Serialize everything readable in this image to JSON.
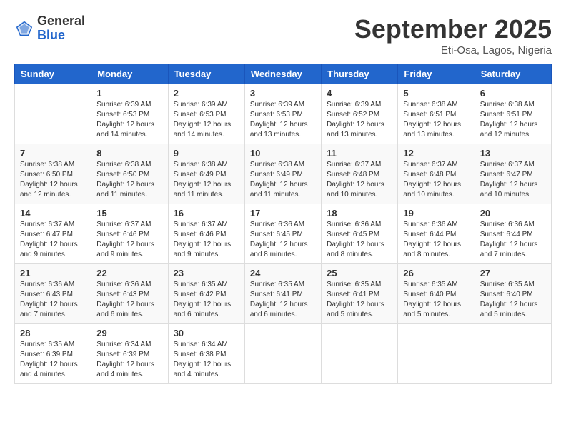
{
  "logo": {
    "general": "General",
    "blue": "Blue"
  },
  "header": {
    "month": "September 2025",
    "location": "Eti-Osa, Lagos, Nigeria"
  },
  "weekdays": [
    "Sunday",
    "Monday",
    "Tuesday",
    "Wednesday",
    "Thursday",
    "Friday",
    "Saturday"
  ],
  "weeks": [
    [
      {
        "day": "",
        "sunrise": "",
        "sunset": "",
        "daylight": ""
      },
      {
        "day": "1",
        "sunrise": "Sunrise: 6:39 AM",
        "sunset": "Sunset: 6:53 PM",
        "daylight": "Daylight: 12 hours and 14 minutes."
      },
      {
        "day": "2",
        "sunrise": "Sunrise: 6:39 AM",
        "sunset": "Sunset: 6:53 PM",
        "daylight": "Daylight: 12 hours and 14 minutes."
      },
      {
        "day": "3",
        "sunrise": "Sunrise: 6:39 AM",
        "sunset": "Sunset: 6:53 PM",
        "daylight": "Daylight: 12 hours and 13 minutes."
      },
      {
        "day": "4",
        "sunrise": "Sunrise: 6:39 AM",
        "sunset": "Sunset: 6:52 PM",
        "daylight": "Daylight: 12 hours and 13 minutes."
      },
      {
        "day": "5",
        "sunrise": "Sunrise: 6:38 AM",
        "sunset": "Sunset: 6:51 PM",
        "daylight": "Daylight: 12 hours and 13 minutes."
      },
      {
        "day": "6",
        "sunrise": "Sunrise: 6:38 AM",
        "sunset": "Sunset: 6:51 PM",
        "daylight": "Daylight: 12 hours and 12 minutes."
      }
    ],
    [
      {
        "day": "7",
        "sunrise": "Sunrise: 6:38 AM",
        "sunset": "Sunset: 6:50 PM",
        "daylight": "Daylight: 12 hours and 12 minutes."
      },
      {
        "day": "8",
        "sunrise": "Sunrise: 6:38 AM",
        "sunset": "Sunset: 6:50 PM",
        "daylight": "Daylight: 12 hours and 11 minutes."
      },
      {
        "day": "9",
        "sunrise": "Sunrise: 6:38 AM",
        "sunset": "Sunset: 6:49 PM",
        "daylight": "Daylight: 12 hours and 11 minutes."
      },
      {
        "day": "10",
        "sunrise": "Sunrise: 6:38 AM",
        "sunset": "Sunset: 6:49 PM",
        "daylight": "Daylight: 12 hours and 11 minutes."
      },
      {
        "day": "11",
        "sunrise": "Sunrise: 6:37 AM",
        "sunset": "Sunset: 6:48 PM",
        "daylight": "Daylight: 12 hours and 10 minutes."
      },
      {
        "day": "12",
        "sunrise": "Sunrise: 6:37 AM",
        "sunset": "Sunset: 6:48 PM",
        "daylight": "Daylight: 12 hours and 10 minutes."
      },
      {
        "day": "13",
        "sunrise": "Sunrise: 6:37 AM",
        "sunset": "Sunset: 6:47 PM",
        "daylight": "Daylight: 12 hours and 10 minutes."
      }
    ],
    [
      {
        "day": "14",
        "sunrise": "Sunrise: 6:37 AM",
        "sunset": "Sunset: 6:47 PM",
        "daylight": "Daylight: 12 hours and 9 minutes."
      },
      {
        "day": "15",
        "sunrise": "Sunrise: 6:37 AM",
        "sunset": "Sunset: 6:46 PM",
        "daylight": "Daylight: 12 hours and 9 minutes."
      },
      {
        "day": "16",
        "sunrise": "Sunrise: 6:37 AM",
        "sunset": "Sunset: 6:46 PM",
        "daylight": "Daylight: 12 hours and 9 minutes."
      },
      {
        "day": "17",
        "sunrise": "Sunrise: 6:36 AM",
        "sunset": "Sunset: 6:45 PM",
        "daylight": "Daylight: 12 hours and 8 minutes."
      },
      {
        "day": "18",
        "sunrise": "Sunrise: 6:36 AM",
        "sunset": "Sunset: 6:45 PM",
        "daylight": "Daylight: 12 hours and 8 minutes."
      },
      {
        "day": "19",
        "sunrise": "Sunrise: 6:36 AM",
        "sunset": "Sunset: 6:44 PM",
        "daylight": "Daylight: 12 hours and 8 minutes."
      },
      {
        "day": "20",
        "sunrise": "Sunrise: 6:36 AM",
        "sunset": "Sunset: 6:44 PM",
        "daylight": "Daylight: 12 hours and 7 minutes."
      }
    ],
    [
      {
        "day": "21",
        "sunrise": "Sunrise: 6:36 AM",
        "sunset": "Sunset: 6:43 PM",
        "daylight": "Daylight: 12 hours and 7 minutes."
      },
      {
        "day": "22",
        "sunrise": "Sunrise: 6:36 AM",
        "sunset": "Sunset: 6:43 PM",
        "daylight": "Daylight: 12 hours and 6 minutes."
      },
      {
        "day": "23",
        "sunrise": "Sunrise: 6:35 AM",
        "sunset": "Sunset: 6:42 PM",
        "daylight": "Daylight: 12 hours and 6 minutes."
      },
      {
        "day": "24",
        "sunrise": "Sunrise: 6:35 AM",
        "sunset": "Sunset: 6:41 PM",
        "daylight": "Daylight: 12 hours and 6 minutes."
      },
      {
        "day": "25",
        "sunrise": "Sunrise: 6:35 AM",
        "sunset": "Sunset: 6:41 PM",
        "daylight": "Daylight: 12 hours and 5 minutes."
      },
      {
        "day": "26",
        "sunrise": "Sunrise: 6:35 AM",
        "sunset": "Sunset: 6:40 PM",
        "daylight": "Daylight: 12 hours and 5 minutes."
      },
      {
        "day": "27",
        "sunrise": "Sunrise: 6:35 AM",
        "sunset": "Sunset: 6:40 PM",
        "daylight": "Daylight: 12 hours and 5 minutes."
      }
    ],
    [
      {
        "day": "28",
        "sunrise": "Sunrise: 6:35 AM",
        "sunset": "Sunset: 6:39 PM",
        "daylight": "Daylight: 12 hours and 4 minutes."
      },
      {
        "day": "29",
        "sunrise": "Sunrise: 6:34 AM",
        "sunset": "Sunset: 6:39 PM",
        "daylight": "Daylight: 12 hours and 4 minutes."
      },
      {
        "day": "30",
        "sunrise": "Sunrise: 6:34 AM",
        "sunset": "Sunset: 6:38 PM",
        "daylight": "Daylight: 12 hours and 4 minutes."
      },
      {
        "day": "",
        "sunrise": "",
        "sunset": "",
        "daylight": ""
      },
      {
        "day": "",
        "sunrise": "",
        "sunset": "",
        "daylight": ""
      },
      {
        "day": "",
        "sunrise": "",
        "sunset": "",
        "daylight": ""
      },
      {
        "day": "",
        "sunrise": "",
        "sunset": "",
        "daylight": ""
      }
    ]
  ]
}
